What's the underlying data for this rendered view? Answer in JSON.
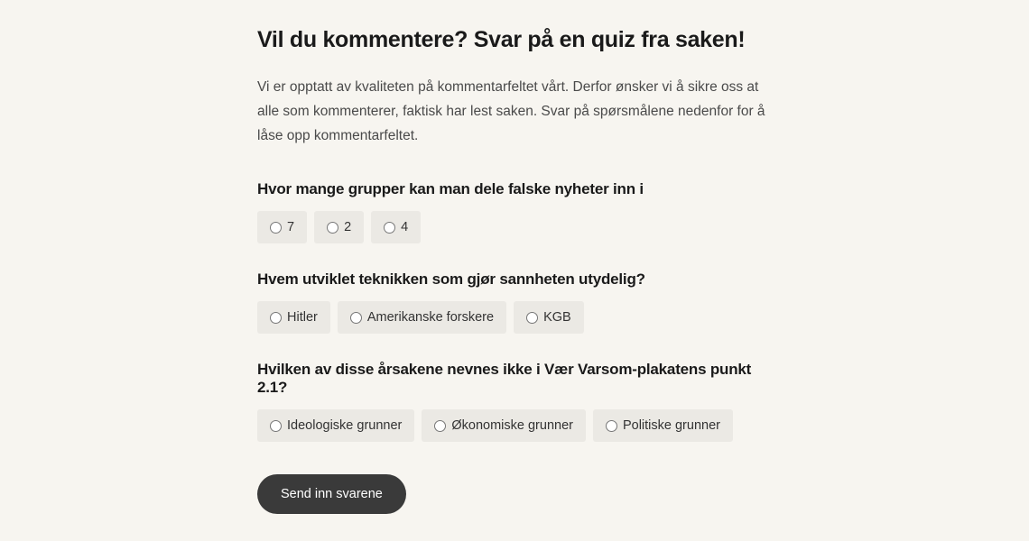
{
  "heading": "Vil du kommentere? Svar på en quiz fra saken!",
  "intro": "Vi er opptatt av kvaliteten på kommentarfeltet vårt. Derfor ønsker vi å sikre oss at alle som kommenterer, faktisk har lest saken. Svar på spørsmålene nedenfor for å låse opp kommentarfeltet.",
  "questions": [
    {
      "text": "Hvor mange grupper kan man dele falske nyheter inn i",
      "options": [
        "7",
        "2",
        "4"
      ]
    },
    {
      "text": "Hvem utviklet teknikken som gjør sannheten utydelig?",
      "options": [
        "Hitler",
        "Amerikanske forskere",
        "KGB"
      ]
    },
    {
      "text": "Hvilken av disse årsakene nevnes ikke i Vær Varsom-plakatens punkt 2.1?",
      "options": [
        "Ideologiske grunner",
        "Økonomiske grunner",
        "Politiske grunner"
      ]
    }
  ],
  "submit_label": "Send inn svarene"
}
